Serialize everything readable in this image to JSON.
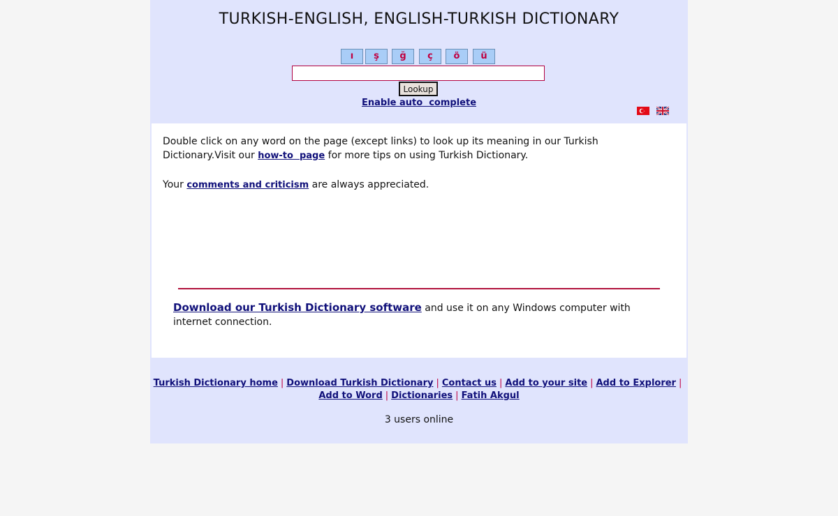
{
  "header": {
    "title": "TURKISH-ENGLISH, ENGLISH-TURKISH DICTIONARY",
    "special_chars": [
      "ı",
      "ş",
      "ğ",
      "ç",
      "ö",
      "ü"
    ],
    "search_value": "",
    "lookup_label": "Lookup",
    "autocomplete_link": "Enable auto  complete",
    "flags": [
      "turkey-flag-icon",
      "uk-flag-icon"
    ]
  },
  "content": {
    "p1_text_a": "Double click on any word on the page (except links) to look up its meaning in our Turkish Dictionary.Visit our ",
    "p1_link": "how-to  page",
    "p1_text_b": " for more tips on using Turkish Dictionary.",
    "p2_text_a": "Your ",
    "p2_link": "comments and criticism",
    "p2_text_b": " are always appreciated.",
    "p3_link": "Download our Turkish Dictionary software",
    "p3_text": " and use it on any Windows computer with internet connection."
  },
  "footer": {
    "links": [
      "Turkish Dictionary home",
      "Download Turkish Dictionary",
      "Contact us",
      "Add to your site",
      "Add to Explorer",
      "Add to Word",
      "Dictionaries",
      "Fatih Akgul"
    ],
    "separator": "|",
    "online_text": "3 users online"
  },
  "colors": {
    "header_bg": "#e0e4fd",
    "link": "#10107a",
    "accent": "#c00040"
  }
}
